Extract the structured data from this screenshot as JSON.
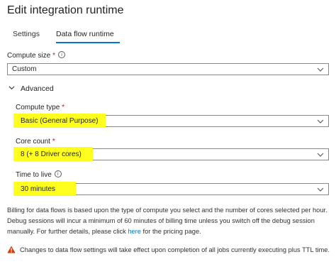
{
  "title": "Edit integration runtime",
  "tabs": [
    {
      "label": "Settings"
    },
    {
      "label": "Data flow runtime"
    }
  ],
  "compute_size": {
    "label": "Compute size",
    "required_marker": "*",
    "value": "Custom"
  },
  "advanced": {
    "label": "Advanced"
  },
  "compute_type": {
    "label": "Compute type",
    "required_marker": "*",
    "value": "Basic (General Purpose)"
  },
  "core_count": {
    "label": "Core count",
    "required_marker": "*",
    "value": "8 (+ 8 Driver cores)"
  },
  "time_to_live": {
    "label": "Time to live",
    "value": "30 minutes"
  },
  "billing": {
    "text_before": "Billing for data flows is based upon the type of compute you select and the number of cores selected per hour. Debug sessions will incur a minimum of 60 minutes of billing time unless you switch off the debug session manually. For further details, please click ",
    "link": "here",
    "text_after": " for the pricing page."
  },
  "warning": {
    "text": "Changes to data flow settings will take effect upon completion of all jobs currently executing plus TTL time."
  },
  "colors": {
    "accent": "#0078d4",
    "highlight": "#ffff1f",
    "required": "#a4262c",
    "warning": "#d83b01"
  }
}
